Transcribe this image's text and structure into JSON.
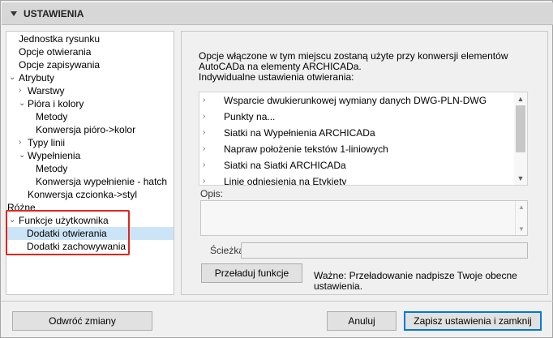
{
  "header": {
    "title": "USTAWIENIA"
  },
  "tree": {
    "items": [
      {
        "label": "Jednostka rysunku",
        "chevron": ""
      },
      {
        "label": "Opcje otwierania",
        "chevron": ""
      },
      {
        "label": "Opcje zapisywania",
        "chevron": ""
      },
      {
        "label": "Atrybuty",
        "chevron": "v"
      },
      {
        "label": "Warstwy",
        "chevron": ">"
      },
      {
        "label": "Pióra i kolory",
        "chevron": "v"
      },
      {
        "label": "Metody",
        "chevron": ""
      },
      {
        "label": "Konwersja pióro->kolor",
        "chevron": ""
      },
      {
        "label": "Typy linii",
        "chevron": ">"
      },
      {
        "label": "Wypełnienia",
        "chevron": "v"
      },
      {
        "label": "Metody",
        "chevron": ""
      },
      {
        "label": "Konwersja wypełnienie - hatch",
        "chevron": ""
      },
      {
        "label": "Konwersja czcionka->styl",
        "chevron": ""
      },
      {
        "label": "Różne",
        "chevron": ""
      },
      {
        "label": "Funkcje użytkownika",
        "chevron": "v"
      },
      {
        "label": "Dodatki otwierania",
        "chevron": "",
        "selected": true
      },
      {
        "label": "Dodatki zachowywania",
        "chevron": ""
      }
    ]
  },
  "panel": {
    "description_line1": "Opcje włączone w tym miejscu zostaną użyte przy konwersji elementów",
    "description_line2": "AutoCADa na elementy ARCHICADa.",
    "description_line3": "Indywidualne ustawienia otwierania:",
    "list": [
      "Wsparcie dwukierunkowej wymiany danych DWG-PLN-DWG",
      "Punkty na...",
      "Siatki na Wypełnienia ARCHICADa",
      "Napraw położenie tekstów 1-liniowych",
      "Siatki na Siatki ARCHICADa",
      "Linie odniesienia na Etykiety"
    ],
    "opis_label": "Opis:",
    "path_label": "Ścieżka:",
    "reload_button": "Przeładuj funkcje",
    "warning_line1": "Ważne: Przeładowanie nadpisze Twoje obecne",
    "warning_line2": "ustawienia."
  },
  "footer": {
    "revert_button": "Odwróć zmiany",
    "cancel_button": "Anuluj",
    "save_button": "Zapisz ustawienia i zamknij"
  },
  "colors": {
    "selection": "#cce4f7",
    "highlight": "#e0261c",
    "primary_border": "#0078d7"
  }
}
